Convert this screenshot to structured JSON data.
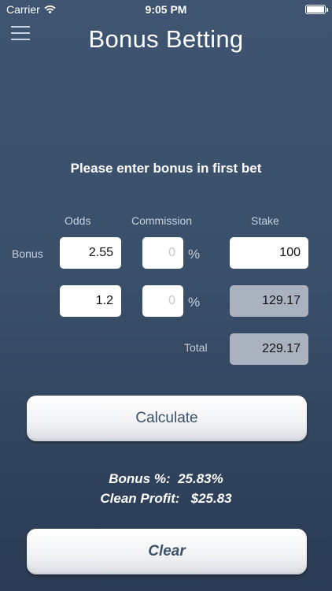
{
  "status": {
    "carrier": "Carrier",
    "time": "9:05 PM"
  },
  "header": {
    "title": "Bonus Betting",
    "menu_icon": "hamburger-icon"
  },
  "instruction": "Please enter bonus in first bet",
  "columns": {
    "odds": "Odds",
    "commission": "Commission",
    "stake": "Stake"
  },
  "rows": {
    "bonus_label": "Bonus",
    "bonus": {
      "odds": "2.55",
      "commission_placeholder": "0",
      "percent": "%",
      "stake": "100"
    },
    "second": {
      "odds": "1.2",
      "commission_placeholder": "0",
      "percent": "%",
      "stake": "129.17"
    },
    "total_label": "Total",
    "total": "229.17"
  },
  "buttons": {
    "calculate": "Calculate",
    "clear": "Clear"
  },
  "results": {
    "bonus_pct_label": "Bonus %:",
    "bonus_pct_value": "25.83%",
    "clean_profit_label": "Clean Profit:",
    "clean_profit_value": "$25.83"
  },
  "colors": {
    "background": "#3a4f6a",
    "button_text": "#3b4f68",
    "readonly_field": "#aab2bf"
  }
}
